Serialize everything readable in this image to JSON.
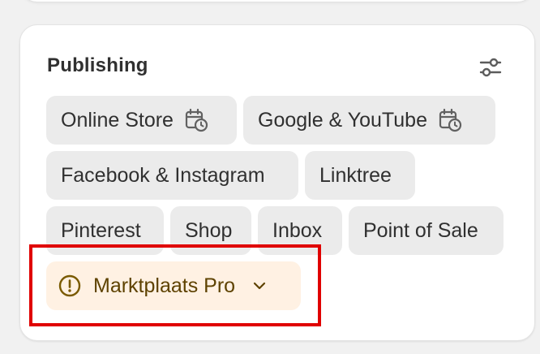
{
  "publishing": {
    "title": "Publishing",
    "manage_icon": "sliders-icon",
    "channels": [
      {
        "label": "Online Store",
        "icon": "calendar-clock-icon"
      },
      {
        "label": "Google & YouTube",
        "icon": "calendar-clock-icon"
      },
      {
        "label": "Facebook & Instagram"
      },
      {
        "label": "Linktree"
      },
      {
        "label": "Pinterest"
      },
      {
        "label": "Shop"
      },
      {
        "label": "Inbox"
      },
      {
        "label": "Point of Sale"
      },
      {
        "label": "Marktplaats Pro",
        "status": "warning",
        "icon": "alert-circle-icon",
        "trailing_icon": "chevron-down-icon"
      }
    ]
  },
  "colors": {
    "pill_bg": "#ebebeb",
    "warning_bg": "#fff1e3",
    "warning_text": "#5e4200",
    "highlight": "#e00000"
  }
}
